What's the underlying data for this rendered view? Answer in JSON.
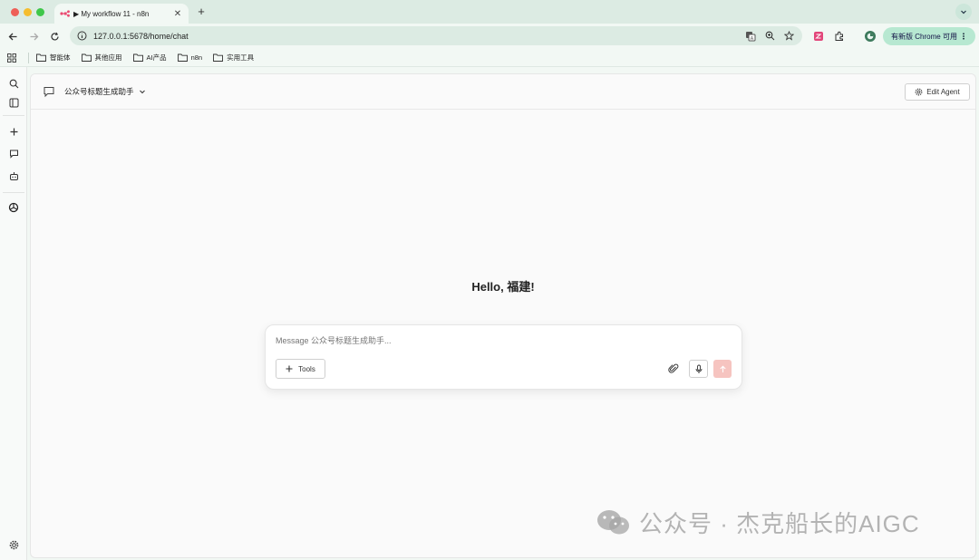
{
  "browser": {
    "tab_title": "▶ My workflow 11 - n8n",
    "url": "127.0.0.1:5678/home/chat",
    "update_button": "有新版 Chrome 可用",
    "bookmarks": [
      "智能体",
      "其他应用",
      "AI产品",
      "n8n",
      "实用工具"
    ]
  },
  "chat": {
    "agent_name": "公众号标题生成助手",
    "edit_agent_label": "Edit Agent",
    "greeting": "Hello, 福建!",
    "input_placeholder": "Message 公众号标题生成助手...",
    "tools_label": "Tools"
  },
  "watermark": "公众号 · 杰克船长的AIGC",
  "colors": {
    "browser_frame": "#dcebe3",
    "update_button_bg": "#b7e8d1",
    "send_button_disabled": "#f6c4c0",
    "app_bg": "#fafafa"
  }
}
